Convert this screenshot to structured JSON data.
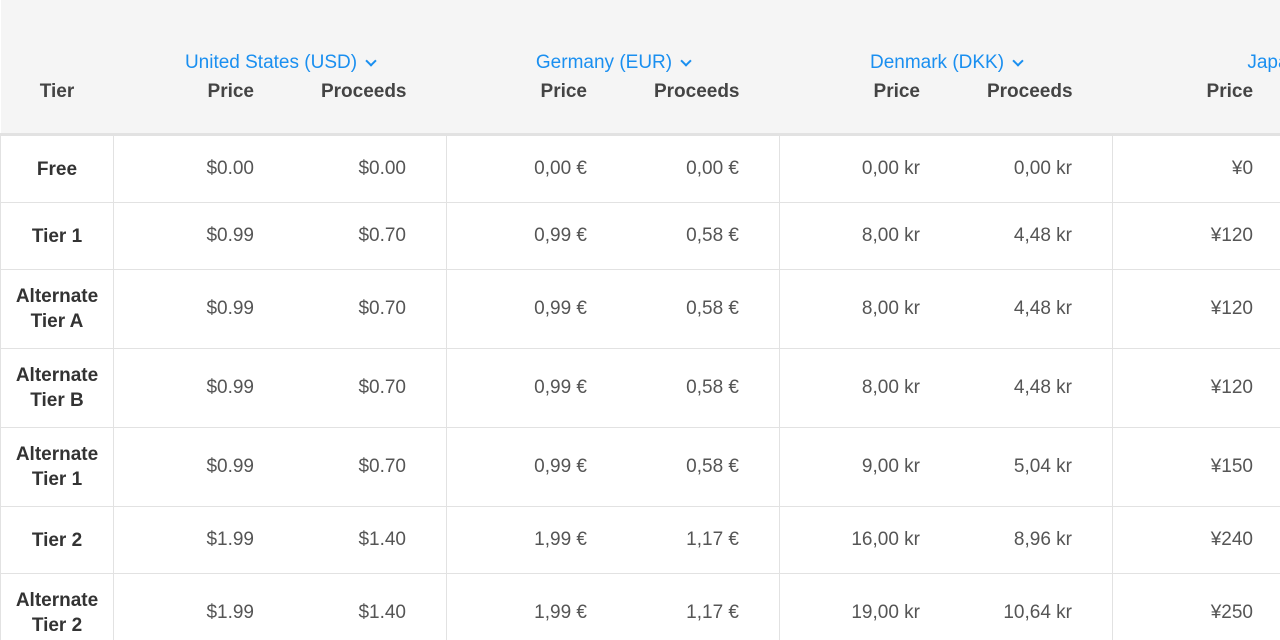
{
  "header": {
    "tier_label": "Tier",
    "price_label": "Price",
    "proceeds_label": "Proceeds",
    "countries": [
      {
        "name": "United States (USD)"
      },
      {
        "name": "Germany (EUR)"
      },
      {
        "name": "Denmark (DKK)"
      },
      {
        "name": "Japan ("
      }
    ]
  },
  "rows": [
    {
      "tier": "Free",
      "cells": [
        "$0.00",
        "$0.00",
        "0,00 €",
        "0,00 €",
        "0,00 kr",
        "0,00 kr",
        "¥0",
        ""
      ]
    },
    {
      "tier": "Tier 1",
      "cells": [
        "$0.99",
        "$0.70",
        "0,99 €",
        "0,58 €",
        "8,00 kr",
        "4,48 kr",
        "¥120",
        ""
      ]
    },
    {
      "tier": "Alternate\nTier A",
      "cells": [
        "$0.99",
        "$0.70",
        "0,99 €",
        "0,58 €",
        "8,00 kr",
        "4,48 kr",
        "¥120",
        ""
      ]
    },
    {
      "tier": "Alternate\nTier B",
      "cells": [
        "$0.99",
        "$0.70",
        "0,99 €",
        "0,58 €",
        "8,00 kr",
        "4,48 kr",
        "¥120",
        ""
      ]
    },
    {
      "tier": "Alternate\nTier 1",
      "cells": [
        "$0.99",
        "$0.70",
        "0,99 €",
        "0,58 €",
        "9,00 kr",
        "5,04 kr",
        "¥150",
        ""
      ]
    },
    {
      "tier": "Tier 2",
      "cells": [
        "$1.99",
        "$1.40",
        "1,99 €",
        "1,17 €",
        "16,00 kr",
        "8,96 kr",
        "¥240",
        ""
      ]
    },
    {
      "tier": "Alternate\nTier 2",
      "cells": [
        "$1.99",
        "$1.40",
        "1,99 €",
        "1,17 €",
        "19,00 kr",
        "10,64 kr",
        "¥250",
        ""
      ]
    }
  ],
  "colors": {
    "link": "#1a8ff0",
    "header_bg": "#f5f5f5",
    "border": "#e2e2e2"
  },
  "icons": {
    "country_dropdown": "chevron-down-icon"
  }
}
